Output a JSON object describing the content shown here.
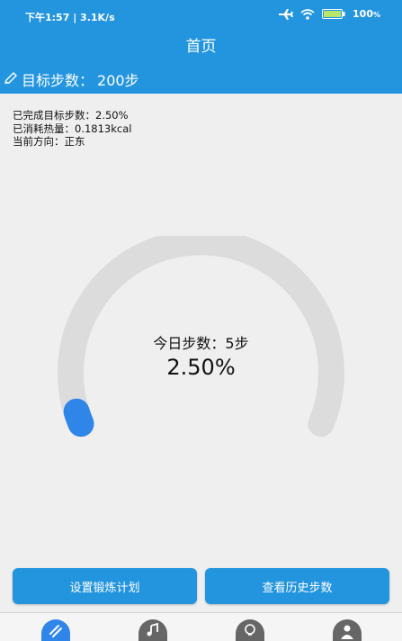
{
  "status_bar": {
    "time_speed": "下午1:57 | 3.1K/s",
    "battery": "100",
    "battery_unit": "%"
  },
  "header": {
    "title": "首页",
    "goal_label": "目标步数：",
    "goal_value": "200步"
  },
  "stats": {
    "completed_label": "已完成目标步数：",
    "completed_value": "2.50%",
    "calories_label": "已消耗热量：",
    "calories_value": "0.1813kcal",
    "direction_label": "当前方向：",
    "direction_value": "正东"
  },
  "gauge": {
    "today_label": "今日步数：",
    "today_value": "5步",
    "percent_text": "2.50%",
    "progress_fraction": 0.025,
    "track_color": "#dcdcdc",
    "progress_color": "#2f86e8"
  },
  "buttons": {
    "set_plan": "设置锻炼计划",
    "view_history": "查看历史步数"
  },
  "colors": {
    "primary": "#2395df",
    "background": "#efefef"
  },
  "tabs": [
    {
      "icon": "running-shoe-icon",
      "active": true
    },
    {
      "icon": "music-icon",
      "active": false
    },
    {
      "icon": "lightbulb-icon",
      "active": false
    },
    {
      "icon": "profile-icon",
      "active": false
    }
  ]
}
